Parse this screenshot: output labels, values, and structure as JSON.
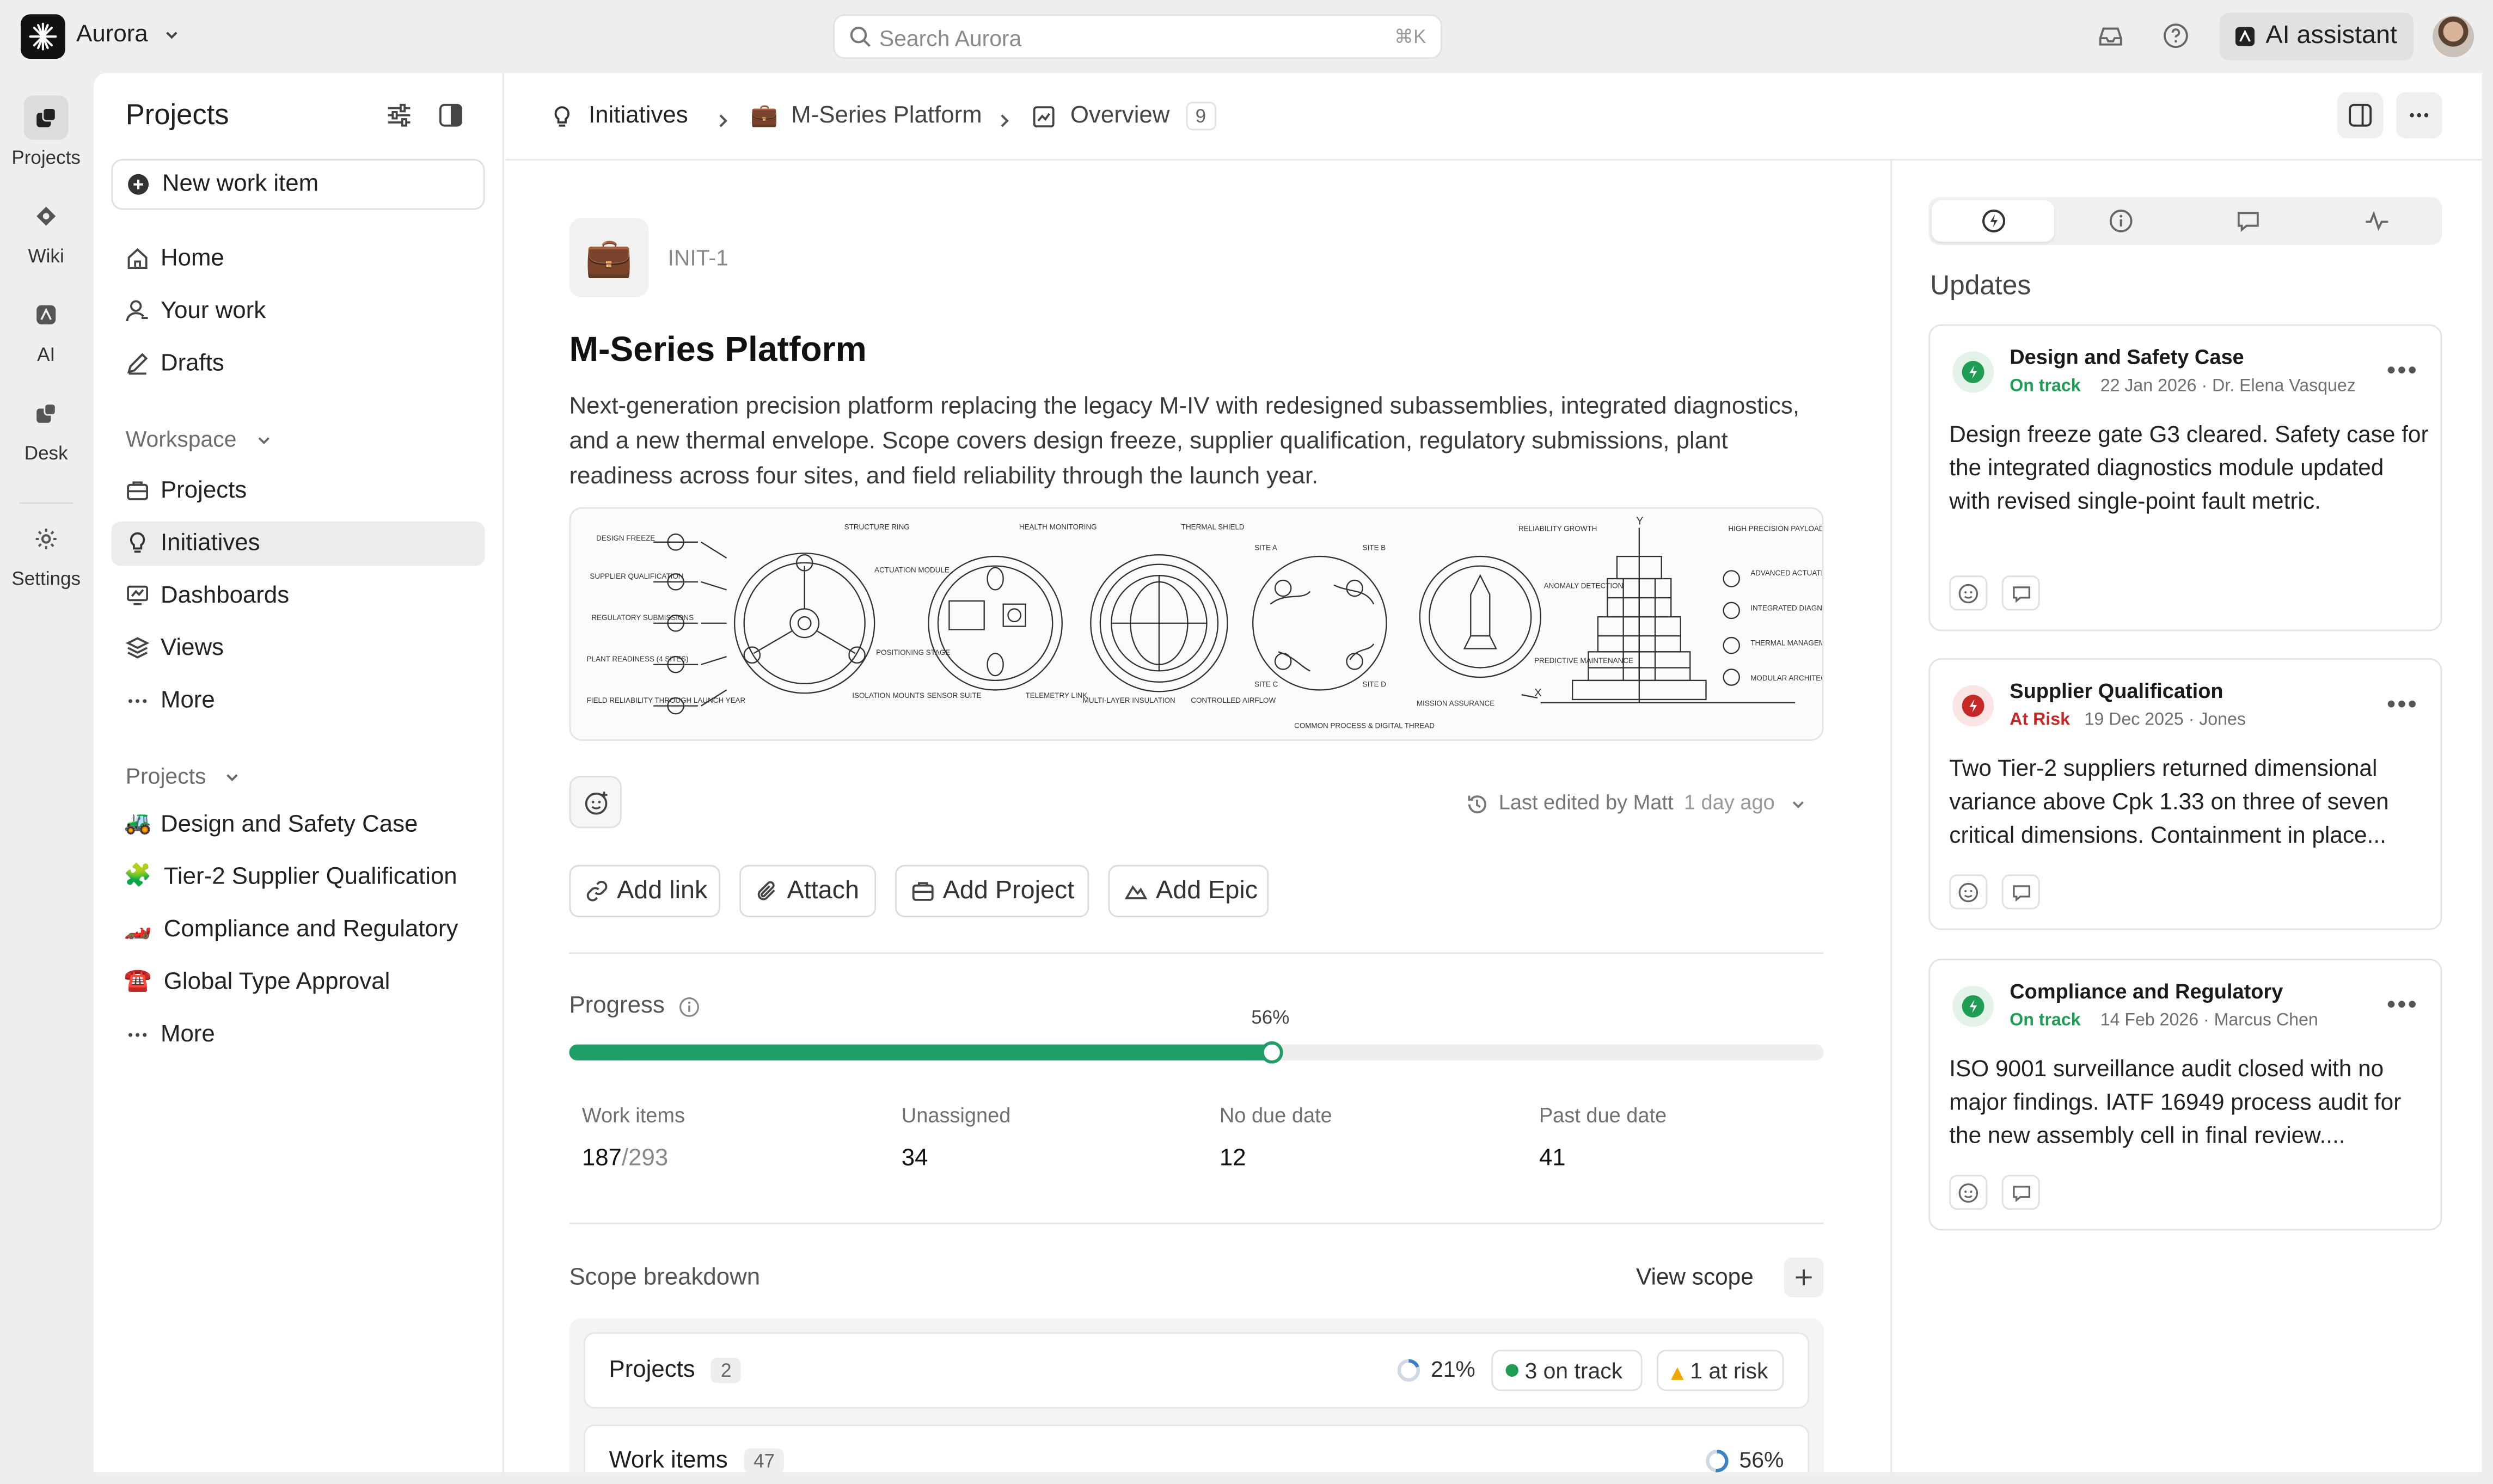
{
  "app": {
    "workspace": "Aurora"
  },
  "search": {
    "placeholder": "Search Aurora",
    "shortcut": "⌘K"
  },
  "topbar": {
    "ai_label": "AI assistant"
  },
  "rail": [
    {
      "label": "Projects"
    },
    {
      "label": "Wiki"
    },
    {
      "label": "AI"
    },
    {
      "label": "Desk"
    },
    {
      "label": "Settings"
    }
  ],
  "sidebar": {
    "title": "Projects",
    "new_item": "New work item",
    "nav": [
      {
        "label": "Home",
        "icon": "home-icon"
      },
      {
        "label": "Your work",
        "icon": "user-icon"
      },
      {
        "label": "Drafts",
        "icon": "pencil-icon"
      }
    ],
    "workspace_heading": "Workspace",
    "workspace": [
      {
        "label": "Projects",
        "icon": "briefcase-icon"
      },
      {
        "label": "Initiatives",
        "icon": "lightbulb-icon"
      },
      {
        "label": "Dashboards",
        "icon": "dashboard-icon"
      },
      {
        "label": "Views",
        "icon": "layers-icon"
      },
      {
        "label": "More",
        "icon": "ellipsis-icon"
      }
    ],
    "projects_heading": "Projects",
    "projects": [
      {
        "emoji": "🚜",
        "label": "Design and Safety Case"
      },
      {
        "emoji": "🧩",
        "label": "Tier-2 Supplier Qualification"
      },
      {
        "emoji": "🏎️",
        "label": "Compliance and Regulatory"
      },
      {
        "emoji": "☎️",
        "label": "Global Type Approval"
      },
      {
        "emoji": "",
        "label": "More"
      }
    ]
  },
  "breadcrumb": {
    "initiatives": "Initiatives",
    "platform": "M-Series Platform",
    "overview": "Overview",
    "overview_count": "9"
  },
  "initiative": {
    "emoji": "💼",
    "id": "INIT-1",
    "title": "M-Series Platform",
    "description": "Next-generation precision platform replacing the legacy M-IV with redesigned subassemblies, integrated diagnostics, and a new thermal envelope. Scope covers design freeze, supplier qualification, regulatory submissions, plant readiness across four sites, and field reliability through the launch year.",
    "last_edited": "Last edited by Matt",
    "last_edited_time": "1 day ago"
  },
  "diagram_labels": {
    "list": [
      "DESIGN FREEZE",
      "SUPPLIER QUALIFICATION",
      "REGULATORY SUBMISSIONS",
      "PLANT READINESS (4 SITES)",
      "FIELD RELIABILITY THROUGH LAUNCH YEAR"
    ],
    "ring": [
      "STRUCTURE RING",
      "ACTUATION MODULE",
      "POSITIONING STAGE",
      "ISOLATION MOUNTS"
    ],
    "health": [
      "HEALTH MONITORING",
      "SENSOR SUITE",
      "TELEMETRY LINK"
    ],
    "thermal": [
      "THERMAL SHIELD",
      "MULTI-LAYER INSULATION",
      "CONTROLLED AIRFLOW"
    ],
    "sites": [
      "SITE A",
      "SITE B",
      "SITE C",
      "SITE D",
      "COMMON PROCESS & DIGITAL THREAD"
    ],
    "growth": [
      "RELIABILITY GROWTH",
      "ANOMALY DETECTION",
      "PREDICTIVE MAINTENANCE",
      "MISSION ASSURANCE"
    ],
    "axes": [
      "Y",
      "X"
    ],
    "arch": [
      "HIGH PRECISION PAYLOAD INTERFACE",
      "ADVANCED ACTUATION",
      "INTEGRATED DIAGNOSTICS",
      "THERMAL MANAGEMENT",
      "MODULAR ARCHITECTURE"
    ]
  },
  "actions": {
    "add_link": "Add link",
    "attach": "Attach",
    "add_project": "Add Project",
    "add_epic": "Add Epic"
  },
  "progress": {
    "label": "Progress",
    "percent_label": "56%",
    "percent": 56,
    "fill_color": "#1f9d66",
    "stats": [
      {
        "label": "Work items",
        "value": "187",
        "total": "/293"
      },
      {
        "label": "Unassigned",
        "value": "34"
      },
      {
        "label": "No due date",
        "value": "12"
      },
      {
        "label": "Past due date",
        "value": "41"
      }
    ]
  },
  "scope": {
    "label": "Scope breakdown",
    "view_scope": "View scope",
    "rows": [
      {
        "label": "Projects",
        "count": "2",
        "percent": "21%",
        "on_track": "3 on track",
        "at_risk": "1 at risk"
      },
      {
        "label": "Work items",
        "count": "47",
        "percent": "56%"
      }
    ]
  },
  "updates": {
    "title": "Updates",
    "items": [
      {
        "title": "Design and Safety Case",
        "status": "On track",
        "status_color": "#1f9d55",
        "meta": "22 Jan 2026 · Dr. Elena Vasquez",
        "body": "Design freeze gate G3 cleared. Safety case for the integrated diagnostics module updated with revised single-point fault metric."
      },
      {
        "title": "Supplier Qualification",
        "status": "At Risk",
        "status_color": "#c62828",
        "meta": "19 Dec 2025 · Jones",
        "body": "Two Tier-2 suppliers returned dimensional variance above Cpk 1.33 on three of seven critical dimensions. Containment in place..."
      },
      {
        "title": "Compliance and Regulatory",
        "status": "On track",
        "status_color": "#1f9d55",
        "meta": "14 Feb 2026 · Marcus Chen",
        "body": "ISO 9001 surveillance audit closed with no major findings. IATF 16949 process audit for the new assembly cell in final review...."
      }
    ]
  }
}
